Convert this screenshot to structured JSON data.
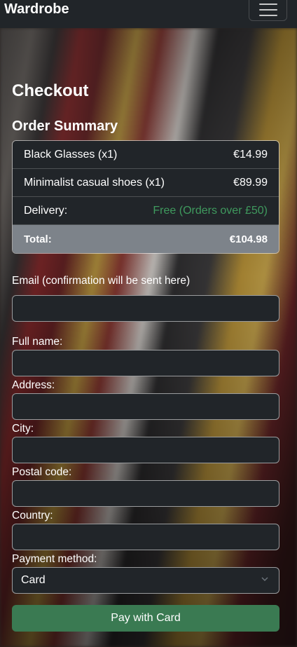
{
  "navbar": {
    "brand": "Wardrobe",
    "menu_icon": "hamburger-menu-icon"
  },
  "page_title": "Checkout",
  "summary": {
    "title": "Order Summary",
    "items": [
      {
        "label": "Black Glasses (x1)",
        "value": "€14.99"
      },
      {
        "label": "Minimalist casual shoes (x1)",
        "value": "€89.99"
      }
    ],
    "delivery": {
      "label": "Delivery:",
      "value": "Free (Orders over £50)"
    },
    "total": {
      "label": "Total:",
      "value": "€104.98"
    }
  },
  "form": {
    "email_label": "Email (confirmation will be sent here)",
    "full_name_label": "Full name:",
    "address_label": "Address:",
    "city_label": "City:",
    "postal_label": "Postal code:",
    "country_label": "Country:",
    "payment_label": "Payment method:",
    "payment_value": "Card",
    "pay_button": "Pay with Card"
  },
  "colors": {
    "navbar": "#212529",
    "success": "#3a7a52",
    "free_text": "#3f9a5e",
    "total_row": "#7d838a"
  }
}
